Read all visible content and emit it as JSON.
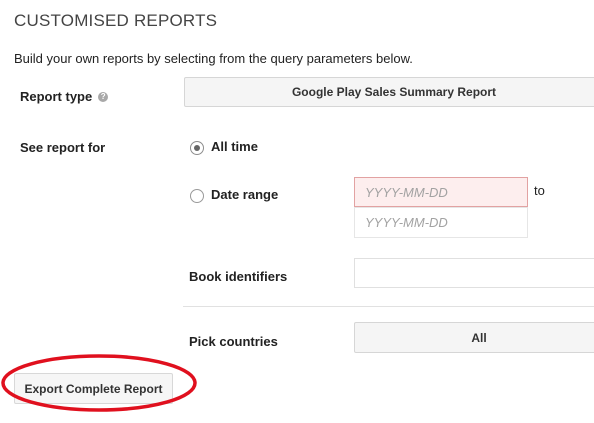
{
  "page": {
    "title": "CUSTOMISED REPORTS",
    "subtitle": "Build your own reports by selecting from the query parameters below."
  },
  "report_type": {
    "label": "Report type",
    "help_icon": "help-icon",
    "selected": "Google Play Sales Summary Report"
  },
  "see_report_for": {
    "label": "See report for",
    "options": [
      {
        "label": "All time",
        "checked": true
      },
      {
        "label": "Date range",
        "checked": false
      }
    ],
    "date_from_placeholder": "YYYY-MM-DD",
    "date_to_placeholder": "YYYY-MM-DD",
    "to_label": "to"
  },
  "book_identifiers": {
    "label": "Book identifiers",
    "value": ""
  },
  "pick_countries": {
    "label": "Pick countries",
    "selected": "All"
  },
  "export": {
    "label": "Export Complete Report",
    "highlight_color": "#e0101e"
  },
  "colors": {
    "error_field_bg": "#fdeeee",
    "error_field_border": "#e2a2a2",
    "button_bg": "#f5f5f5"
  }
}
